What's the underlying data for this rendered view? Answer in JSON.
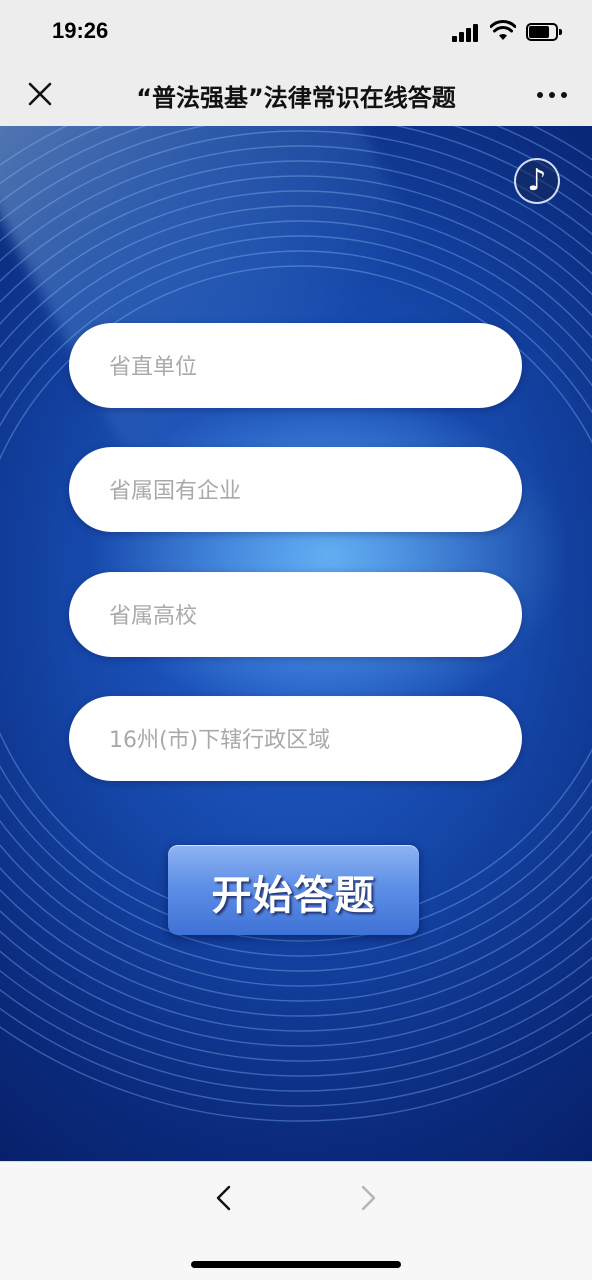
{
  "status_bar": {
    "time": "19:26",
    "icons": [
      "signal-icon",
      "wifi-icon",
      "battery-icon"
    ]
  },
  "nav": {
    "title": "“普法强基”法律常识在线答题",
    "close_icon": "close-icon",
    "more_icon": "more-icon"
  },
  "content": {
    "music_icon": "♪",
    "options": [
      {
        "label": "省直单位"
      },
      {
        "label": "省属国有企业"
      },
      {
        "label": "省属高校"
      },
      {
        "label": "16州(市)下辖行政区域"
      }
    ],
    "start_button": "开始答题"
  },
  "bottom_bar": {
    "back_icon": "chevron-left-icon",
    "forward_icon": "chevron-right-icon"
  },
  "colors": {
    "background_dark": "#0b2a7d",
    "background_mid": "#1546a8",
    "highlight": "#78c8ff",
    "button_top": "#8fb4f3",
    "button_bottom": "#3f72d6",
    "placeholder_text": "#a9a9a9"
  }
}
